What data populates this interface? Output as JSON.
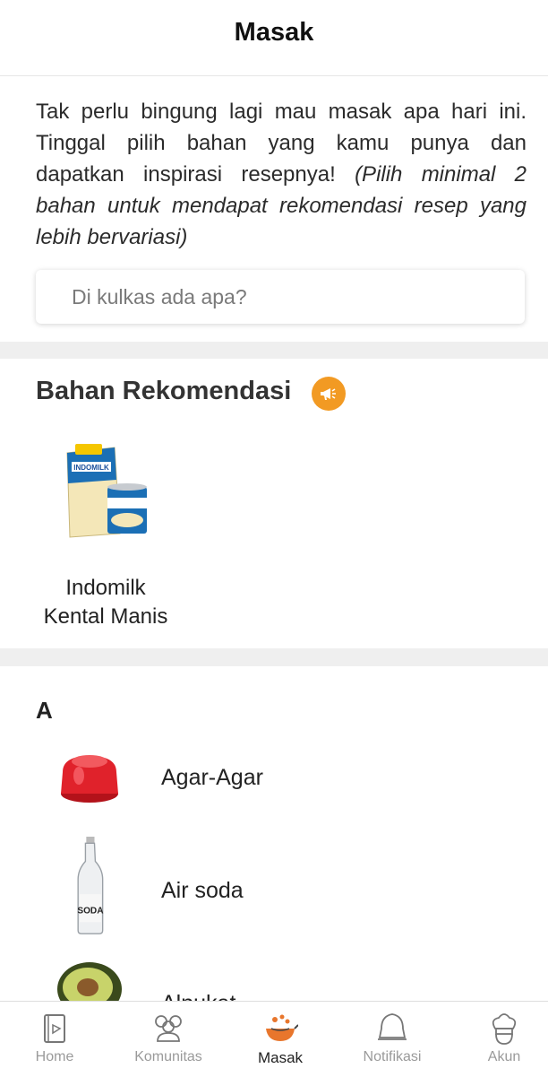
{
  "header": {
    "title": "Masak"
  },
  "intro": {
    "text": "Tak perlu bingung lagi mau masak apa hari ini. Tinggal pilih bahan yang kamu punya dan dapatkan inspirasi resepnya!",
    "hint": "(Pilih minimal 2 bahan untuk mendapat rekomendasi resep yang lebih bervariasi)"
  },
  "search": {
    "placeholder": "Di kulkas ada apa?",
    "value": ""
  },
  "recommended": {
    "title": "Bahan Rekomendasi",
    "icon": "megaphone-icon",
    "accent": "#f29a23",
    "items": [
      {
        "label_line1": "Indomilk",
        "label_line2": "Kental Manis",
        "image_text": "INDOMILK"
      }
    ]
  },
  "ingredients": {
    "letter": "A",
    "items": [
      {
        "label": "Agar-Agar",
        "icon": "jelly-icon"
      },
      {
        "label": "Air soda",
        "icon": "soda-bottle-icon",
        "image_text": "SODA"
      },
      {
        "label": "Alpukat",
        "icon": "avocado-icon"
      }
    ]
  },
  "nav": {
    "items": [
      {
        "label": "Home",
        "icon": "home-icon"
      },
      {
        "label": "Komunitas",
        "icon": "community-icon"
      },
      {
        "label": "Masak",
        "icon": "wok-icon",
        "active": true
      },
      {
        "label": "Notifikasi",
        "icon": "bell-icon"
      },
      {
        "label": "Akun",
        "icon": "chef-hat-icon"
      }
    ],
    "active_color": "#e8762c"
  }
}
